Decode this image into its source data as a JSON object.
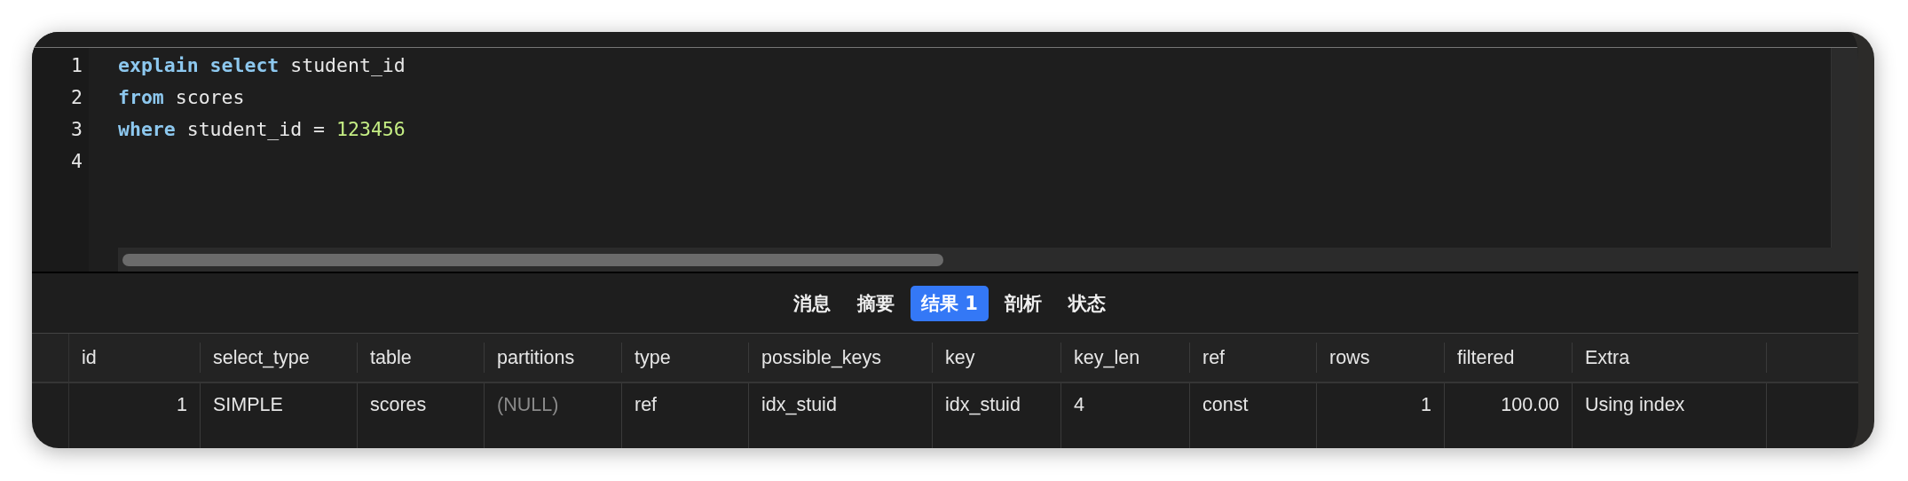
{
  "editor": {
    "lines": [
      {
        "number": "1",
        "tokens": [
          {
            "kind": "keyword",
            "text": "explain"
          },
          {
            "kind": "keyword",
            "text": "select"
          },
          {
            "kind": "plain",
            "text": "student_id"
          }
        ]
      },
      {
        "number": "2",
        "tokens": [
          {
            "kind": "keyword",
            "text": "from"
          },
          {
            "kind": "plain",
            "text": "scores"
          }
        ]
      },
      {
        "number": "3",
        "tokens": [
          {
            "kind": "keyword",
            "text": "where"
          },
          {
            "kind": "plain",
            "text": "student_id ="
          },
          {
            "kind": "number",
            "text": "123456"
          }
        ]
      },
      {
        "number": "4"
      }
    ]
  },
  "tabs": [
    {
      "label": "消息",
      "selected": false
    },
    {
      "label": "摘要",
      "selected": false
    },
    {
      "label": "结果 1",
      "selected": true
    },
    {
      "label": "剖析",
      "selected": false
    },
    {
      "label": "状态",
      "selected": false
    }
  ],
  "table": {
    "columns": [
      "id",
      "select_type",
      "table",
      "partitions",
      "type",
      "possible_keys",
      "key",
      "key_len",
      "ref",
      "rows",
      "filtered",
      "Extra"
    ],
    "rows": [
      {
        "cells": [
          {
            "text": "1",
            "null": false
          },
          {
            "text": "SIMPLE",
            "null": false
          },
          {
            "text": "scores",
            "null": false
          },
          {
            "text": "(NULL)",
            "null": true
          },
          {
            "text": "ref",
            "null": false
          },
          {
            "text": "idx_stuid",
            "null": false
          },
          {
            "text": "idx_stuid",
            "null": false
          },
          {
            "text": "4",
            "null": false
          },
          {
            "text": "const",
            "null": false
          },
          {
            "text": "1",
            "null": false
          },
          {
            "text": "100.00",
            "null": false
          },
          {
            "text": "Using index",
            "null": false
          }
        ]
      }
    ]
  }
}
